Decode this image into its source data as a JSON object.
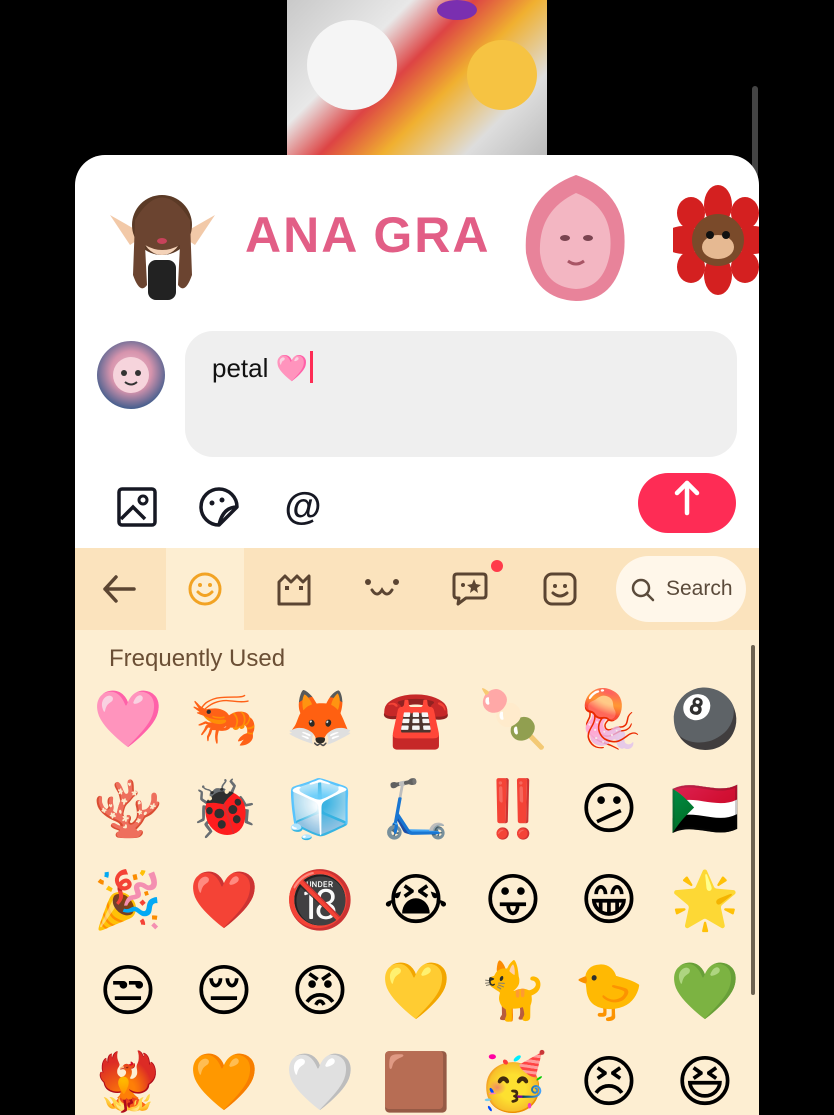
{
  "sticker_strip": {
    "items": [
      "avatar-girl-sticker",
      "ana-gra-banner",
      "rose-petal-face",
      "monkey-flower"
    ],
    "banner_text": "ANA GRA"
  },
  "composer": {
    "text": "petal 🩷",
    "send_icon": "arrow-up-icon",
    "tools": [
      "image-icon",
      "sticker-icon",
      "at-icon"
    ],
    "at_symbol": "@",
    "send_color": "#fe2c55"
  },
  "keyboard": {
    "toolbar": [
      "back-arrow-icon",
      "emoji-icon",
      "gif-icon",
      "kaomoji-icon",
      "sticker-icon",
      "face-icon"
    ],
    "search_label": "Search",
    "section_title": "Frequently Used",
    "emoji_rows": [
      [
        "🩷",
        "🦐",
        "🦊",
        "☎️",
        "🍡",
        "🪼",
        "🎱"
      ],
      [
        "🪸",
        "🐞",
        "🧊",
        "🛴",
        "‼️",
        "😕",
        "🇸🇩"
      ],
      [
        "🎉",
        "❤️",
        "🔞",
        "😭",
        "😛",
        "😁",
        "🌟"
      ],
      [
        "😒",
        "😔",
        "😡",
        "💛",
        "🐈",
        "🐤",
        "💚"
      ],
      [
        "🐦‍🔥",
        "🧡",
        "🤍",
        "🟫",
        "🥳",
        "😣",
        "😆"
      ]
    ],
    "accent_bg": "#fdeed2",
    "toolbar_bg": "#fbe3bd"
  }
}
